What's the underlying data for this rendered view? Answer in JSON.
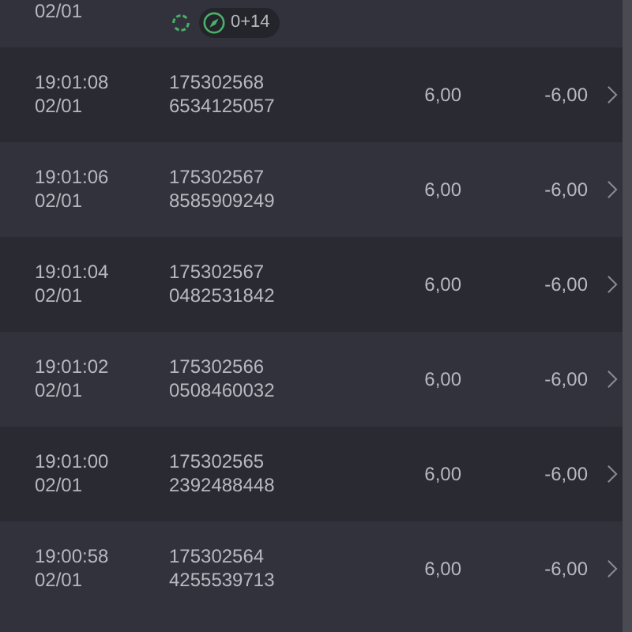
{
  "partial_row": {
    "date": "02/01",
    "badge": "0+14"
  },
  "rows": [
    {
      "time": "19:01:08",
      "date": "02/01",
      "id_line_1": "175302568",
      "id_line_2": "6534125057",
      "amount": "6,00",
      "result": "-6,00"
    },
    {
      "time": "19:01:06",
      "date": "02/01",
      "id_line_1": "175302567",
      "id_line_2": "8585909249",
      "amount": "6,00",
      "result": "-6,00"
    },
    {
      "time": "19:01:04",
      "date": "02/01",
      "id_line_1": "175302567",
      "id_line_2": "0482531842",
      "amount": "6,00",
      "result": "-6,00"
    },
    {
      "time": "19:01:02",
      "date": "02/01",
      "id_line_1": "175302566",
      "id_line_2": "0508460032",
      "amount": "6,00",
      "result": "-6,00"
    },
    {
      "time": "19:01:00",
      "date": "02/01",
      "id_line_1": "175302565",
      "id_line_2": "2392488448",
      "amount": "6,00",
      "result": "-6,00"
    },
    {
      "time": "19:00:58",
      "date": "02/01",
      "id_line_1": "175302564",
      "id_line_2": "4255539713",
      "amount": "6,00",
      "result": "-6,00"
    }
  ]
}
